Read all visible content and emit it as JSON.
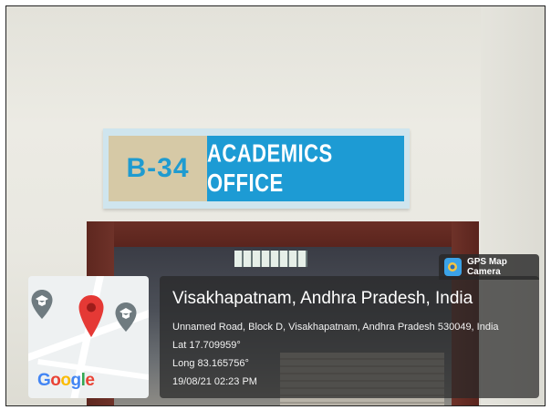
{
  "sign": {
    "code": "B-34",
    "title": "ACADEMICS OFFICE",
    "code_color": "#1f9bd0",
    "title_bg": "#1d9bd4"
  },
  "overlay": {
    "app_name": "GPS Map Camera",
    "place": "Visakhapatnam, Andhra Pradesh, India",
    "address": "Unnamed Road, Block D, Visakhapatnam, Andhra Pradesh 530049, India",
    "latitude": "Lat 17.709959°",
    "longitude": "Long 83.165756°",
    "datetime": "19/08/21 02:23 PM"
  },
  "map": {
    "logo_letters": [
      "G",
      "o",
      "o",
      "g",
      "l",
      "e"
    ],
    "pin_icon": "map-pin-icon",
    "pin_color": "#e53935"
  }
}
